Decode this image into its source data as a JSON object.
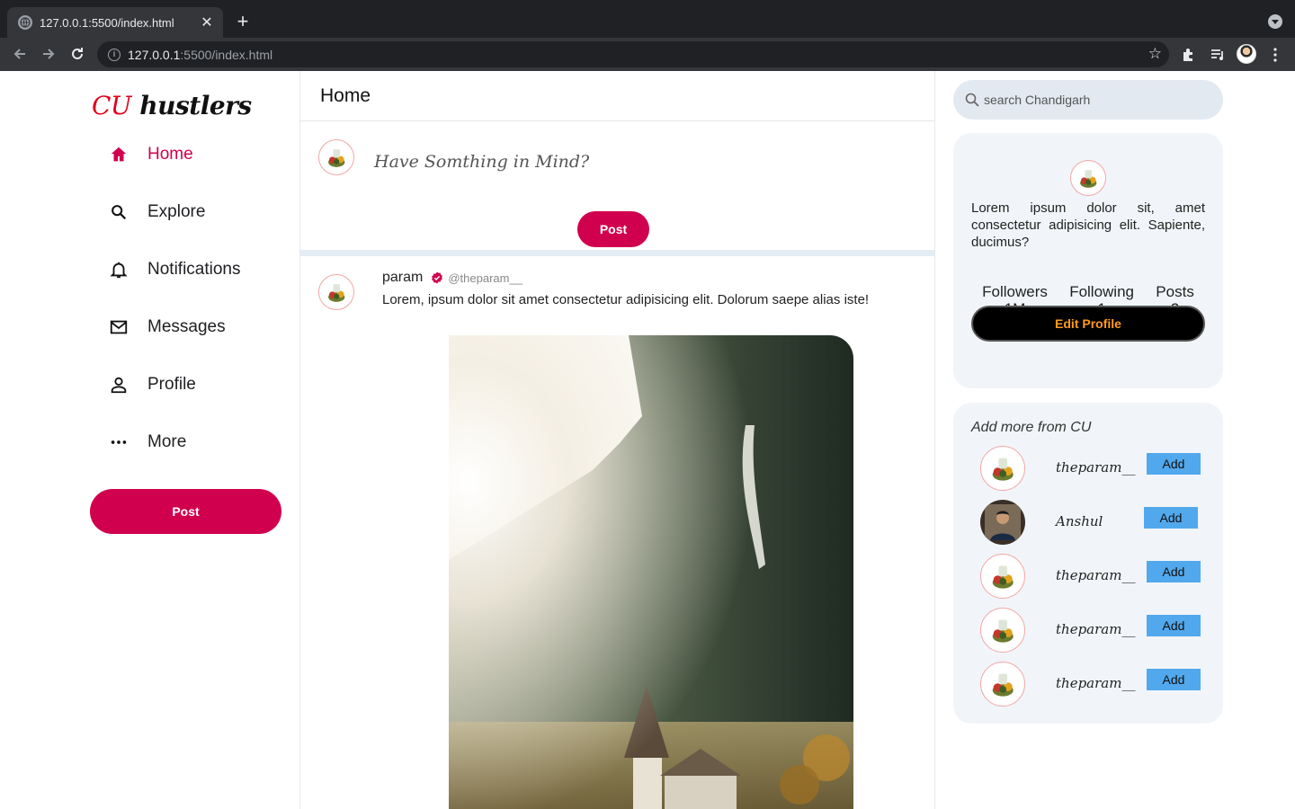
{
  "browser": {
    "tab_title": "127.0.0.1:5500/index.html",
    "tab_close": "✕",
    "new_tab": "+",
    "url_host": "127.0.0.1",
    "url_path": ":5500/index.html"
  },
  "logo": {
    "part1": "CU",
    "part2": " hustlers"
  },
  "sidebar": {
    "items": [
      {
        "label": "Home",
        "icon": "home-icon"
      },
      {
        "label": "Explore",
        "icon": "search-icon"
      },
      {
        "label": "Notifications",
        "icon": "bell-icon"
      },
      {
        "label": "Messages",
        "icon": "mail-icon"
      },
      {
        "label": "Profile",
        "icon": "person-icon"
      },
      {
        "label": "More",
        "icon": "more-icon"
      }
    ],
    "post_label": "Post"
  },
  "center": {
    "title": "Home",
    "composer": {
      "prompt": "Have Somthing in Mind?",
      "post_label": "Post"
    },
    "post": {
      "name": "param",
      "handle": "@theparam__",
      "text": "Lorem, ipsum dolor sit amet consectetur adipisicing elit. Dolorum saepe alias iste!"
    }
  },
  "right": {
    "search_placeholder": "search Chandigarh",
    "profile": {
      "bio": "Lorem ipsum dolor sit, amet consectetur adipisicing elit. Sapiente, ducimus?",
      "stats": [
        {
          "label": "Followers",
          "value": "1M"
        },
        {
          "label": "Following",
          "value": "1"
        },
        {
          "label": "Posts",
          "value": "3"
        }
      ],
      "edit_label": "Edit Profile"
    },
    "suggestions": {
      "title": "Add more from CU",
      "add_label": "Add",
      "users": [
        {
          "name": "theparam__"
        },
        {
          "name": "Anshul"
        },
        {
          "name": "theparam__"
        },
        {
          "name": "theparam__"
        },
        {
          "name": "theparam__"
        }
      ]
    }
  },
  "colors": {
    "accent": "#d1004e",
    "add_button": "#52a8ec",
    "edit_text": "#ff9a1a"
  }
}
